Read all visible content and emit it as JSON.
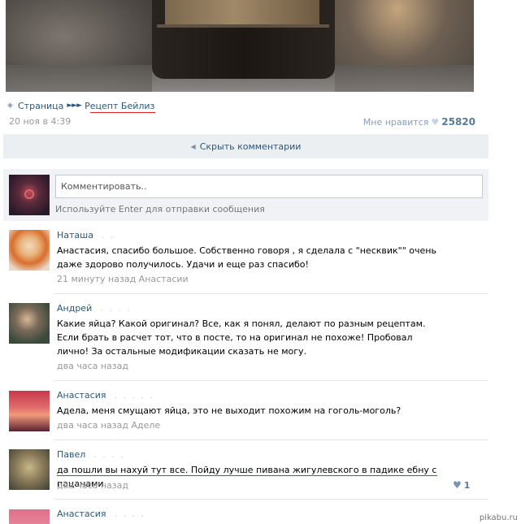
{
  "breadcrumb": {
    "page_label": "Страница",
    "arrows": "►►►",
    "post_title": "Рецепт Бейлиз"
  },
  "post": {
    "date": "20 ноя в 4:39",
    "like_label": "Мне нравится",
    "like_count": "25820"
  },
  "hide_comments": "Скрыть комментарии",
  "compose": {
    "placeholder": "Комментировать..",
    "hint": "Используйте Enter для отправки сообщения"
  },
  "comments": [
    {
      "author": "Наташа",
      "text": "Анастасия, спасибо большое. Собственно говоря , я сделала с \"несквик\"\" очень даже здорово получилось. Удачи и еще раз спасибо!",
      "meta": "21 минуту назад Анастасии"
    },
    {
      "author": "Андрей",
      "text": "Какие яйца? Какой оригинал? Все, как я понял, делают по разным рецептам. Если брать в расчет тот, что в посте, то на оригинал не похоже! Пробовал лично! За остальные модификации сказать не могу.",
      "meta": "два часа назад"
    },
    {
      "author": "Анастасия",
      "text": "Адела, меня смущают яйца, это не выходит похожим на гоголь-моголь?",
      "meta": "два часа назад Аделе"
    },
    {
      "author": "Павел",
      "text": "да пошли вы нахуй тут все. Пойду лучше пивана жигулевского в падике ебну с пацанами",
      "meta": "два часа назад",
      "likes": "1"
    },
    {
      "author": "Анастасия"
    }
  ],
  "watermark": "pikabu.ru",
  "colors": {
    "link": "#2b587a",
    "meta": "#999999",
    "underline": "#dd2222"
  }
}
